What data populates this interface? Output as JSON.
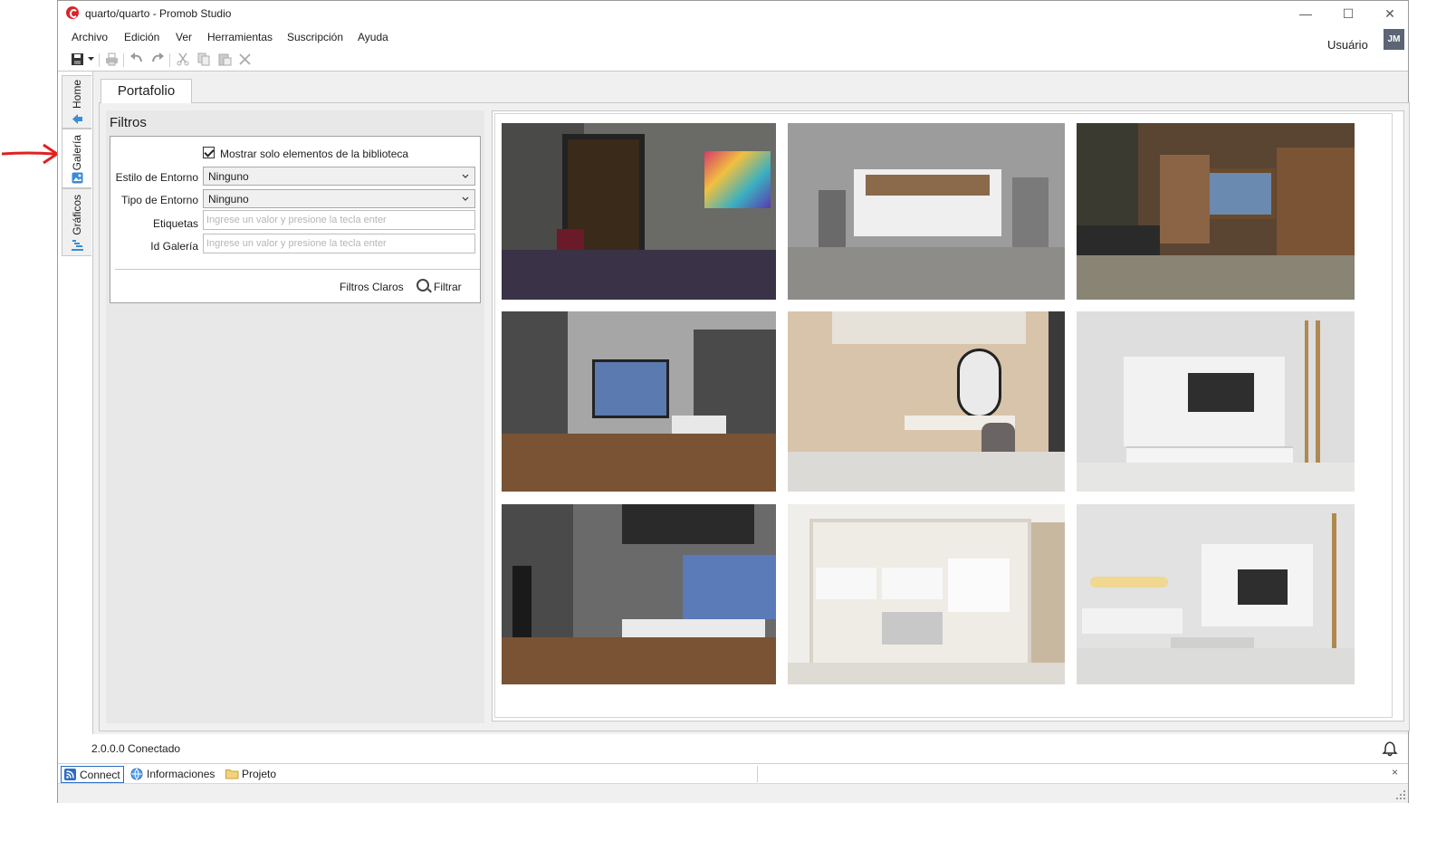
{
  "window": {
    "title": "quarto/quarto - Promob Studio",
    "controls": {
      "minimize": "—",
      "maximize": "☐",
      "close": "✕"
    }
  },
  "menu": [
    "Archivo",
    "Edición",
    "Ver",
    "Herramientas",
    "Suscripción",
    "Ayuda"
  ],
  "user": {
    "label": "Usuário",
    "initials": "JM"
  },
  "side_tabs": [
    {
      "label": "Home",
      "icon": "home-arrow-icon"
    },
    {
      "label": "Galería",
      "icon": "gallery-icon"
    },
    {
      "label": "Gráficos",
      "icon": "chart-icon"
    }
  ],
  "main_tab": "Portafolio",
  "filters": {
    "title": "Filtros",
    "library_only_label": "Mostrar solo elementos de la biblioteca",
    "library_only_checked": true,
    "estilo_label": "Estilo de Entorno",
    "estilo_value": "Ninguno",
    "tipo_label": "Tipo de Entorno",
    "tipo_value": "Ninguno",
    "etiquetas_label": "Etiquetas",
    "etiquetas_placeholder": "Ingrese un valor y presione la tecla enter",
    "id_label": "Id Galería",
    "id_placeholder": "Ingrese un valor y presione la tecla enter",
    "clear_label": "Filtros Claros",
    "filter_label": "Filtrar"
  },
  "status": {
    "text": "2.0.0.0  Conectado"
  },
  "bottom_tabs": [
    {
      "label": "Connect",
      "icon": "rss-icon"
    },
    {
      "label": "Informaciones",
      "icon": "globe-icon"
    },
    {
      "label": "Projeto",
      "icon": "folder-icon"
    }
  ],
  "close_label": "×",
  "colors": {
    "accent": "#2b6cc4",
    "arrow": "#e02020",
    "logo": "#d8262b"
  }
}
